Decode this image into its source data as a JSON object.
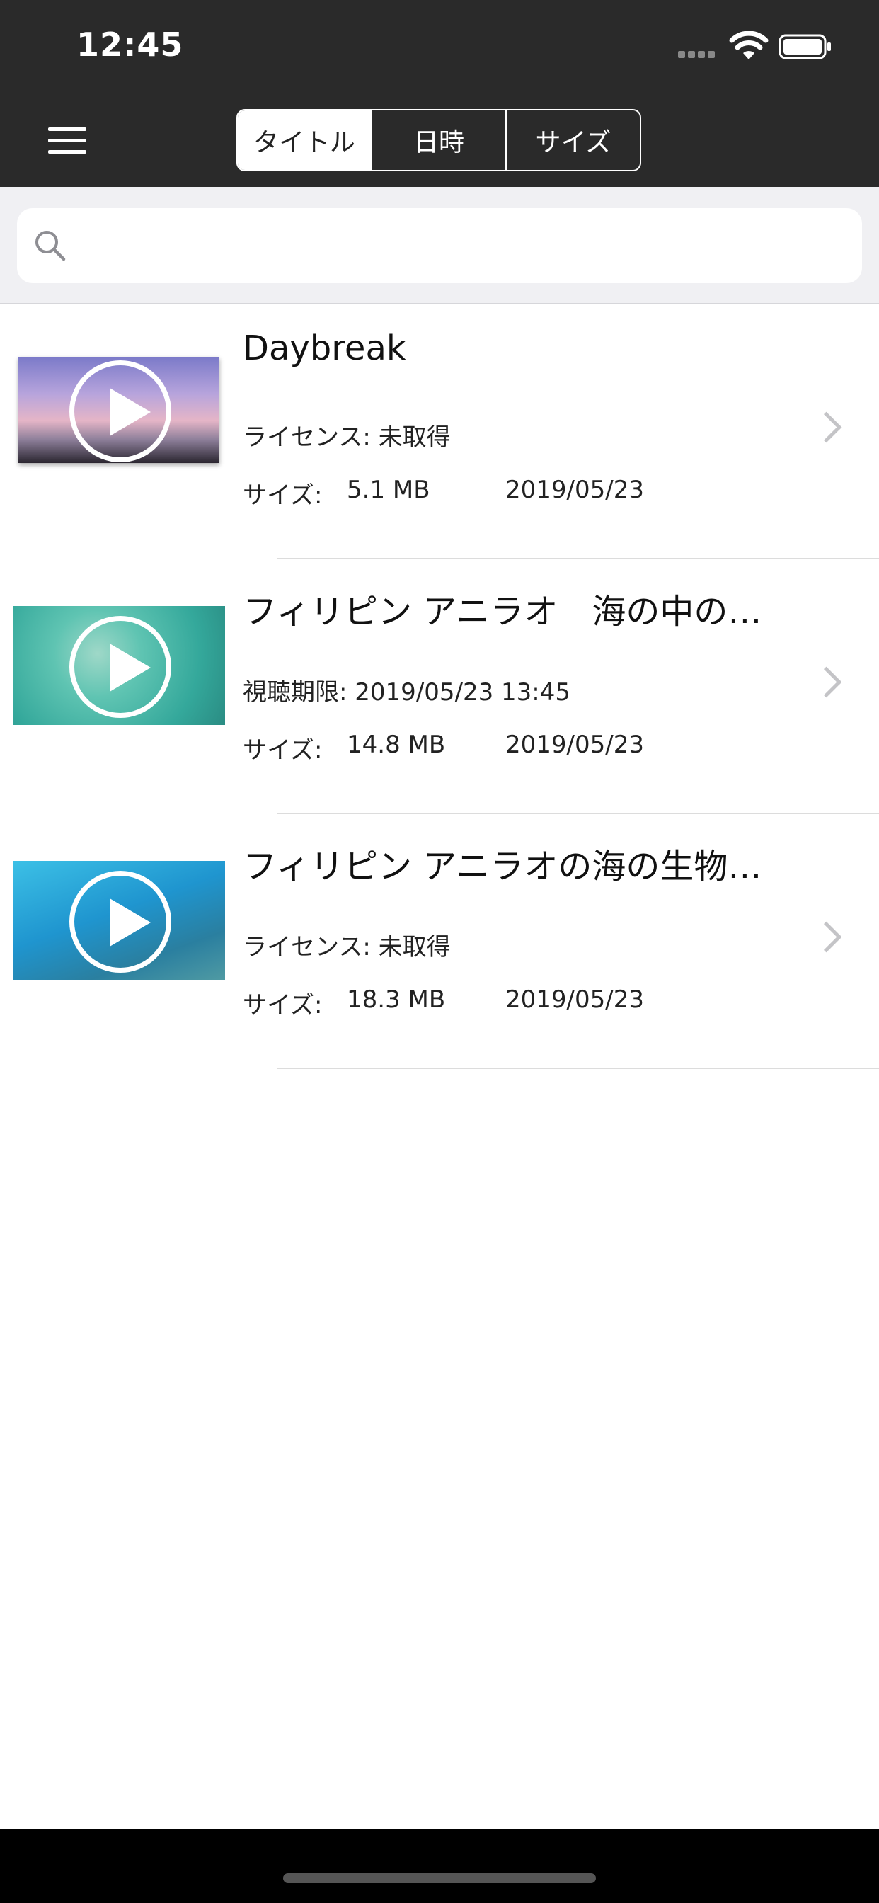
{
  "status_bar": {
    "time": "12:45",
    "icons": [
      "cellular-signal-icon",
      "wifi-icon",
      "battery-icon"
    ]
  },
  "nav": {
    "menu_icon": "hamburger-menu-icon",
    "sort_tabs": [
      {
        "label": "タイトル",
        "selected": true
      },
      {
        "label": "日時",
        "selected": false
      },
      {
        "label": "サイズ",
        "selected": false
      }
    ]
  },
  "search": {
    "placeholder": "",
    "value": "",
    "icon": "search-icon"
  },
  "videos": [
    {
      "title": "Daybreak",
      "meta": "ライセンス: 未取得",
      "size_label": "サイズ:",
      "size": "5.1 MB",
      "date": "2019/05/23",
      "thumb_colors": [
        "#b3a2d8",
        "#e3b3c3"
      ]
    },
    {
      "title": "フィリピン アニラオ　海の中の…",
      "meta": "視聴期限: 2019/05/23 13:45",
      "size_label": "サイズ:",
      "size": "14.8 MB",
      "date": "2019/05/23",
      "thumb_colors": [
        "#39b9a8",
        "#7fcfc0"
      ]
    },
    {
      "title": "フィリピン アニラオの海の生物…",
      "meta": "ライセンス: 未取得",
      "size_label": "サイズ:",
      "size": "18.3 MB",
      "date": "2019/05/23",
      "thumb_colors": [
        "#1f8fc9",
        "#3bb6dd"
      ]
    }
  ]
}
